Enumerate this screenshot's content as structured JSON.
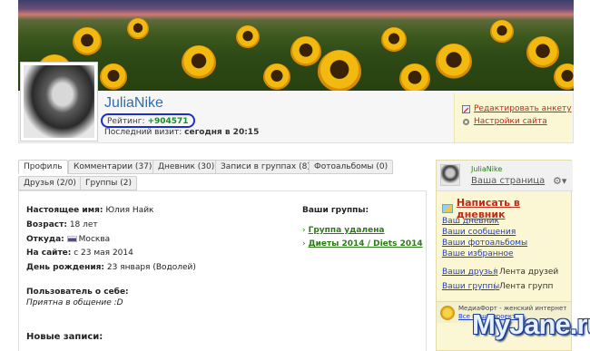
{
  "profile": {
    "username": "JuliaNike",
    "rating_label": "Рейтинг:",
    "rating_value": "+904571",
    "last_visit_label": "Последний визит:",
    "last_visit_value": "сегодня в 20:15"
  },
  "actions": {
    "edit_profile": "Редактировать анкету",
    "site_settings": "Настройки сайта"
  },
  "tabs": [
    {
      "label": "Профиль",
      "active": true
    },
    {
      "label": "Комментарии (37)",
      "active": false
    },
    {
      "label": "Дневник (30)",
      "active": false
    },
    {
      "label": "Записи в группах (8)",
      "active": false
    },
    {
      "label": "Фотоальбомы (0)",
      "active": false
    },
    {
      "label": "Друзья (2/0)",
      "active": false
    },
    {
      "label": "Группы (2)",
      "active": false
    }
  ],
  "info": {
    "real_name_label": "Настоящее имя:",
    "real_name": "Юлия Найк",
    "age_label": "Возраст:",
    "age": "18 лет",
    "from_label": "Откуда:",
    "from": "Москва",
    "on_site_label": "На сайте:",
    "on_site": "с 23 мая 2014",
    "birthday_label": "День рождения:",
    "birthday": "23 января (Водолей)",
    "about_label": "Пользователь о себе:",
    "about_text": "Приятна в общение :D",
    "new_posts_label": "Новые записи:"
  },
  "groups": {
    "title": "Ваши группы:",
    "items": [
      "Группа удалена",
      "Диеты 2014 / Diets 2014"
    ]
  },
  "sidebar": {
    "user_name": "JuliaNike",
    "your_page": "Ваша страница",
    "write_diary": "Написать в дневник",
    "links": [
      "Ваш дневник",
      "Ваши сообщения",
      "Ваши фотоальбомы",
      "Ваше избранное"
    ],
    "friends": "Ваши друзья",
    "friends_feed": "Лента друзей",
    "groups": "Ваши группы",
    "groups_feed": "Лента групп",
    "media_text": "МедиаФорт - женский интернет",
    "media_sub": "Все наши проекты"
  },
  "watermark": "MyJane.ru",
  "colors": {
    "link_red": "#c12a1a",
    "link_green": "#2d7a16",
    "link_blue": "#1e3fbf",
    "username_blue": "#2b6fb3",
    "rating_outline": "#1b2fd0"
  },
  "icons": {
    "edit": "pencil-icon",
    "settings": "gear-icon",
    "gear_menu": "gear-icon",
    "arrow": "arrow-right-icon"
  }
}
